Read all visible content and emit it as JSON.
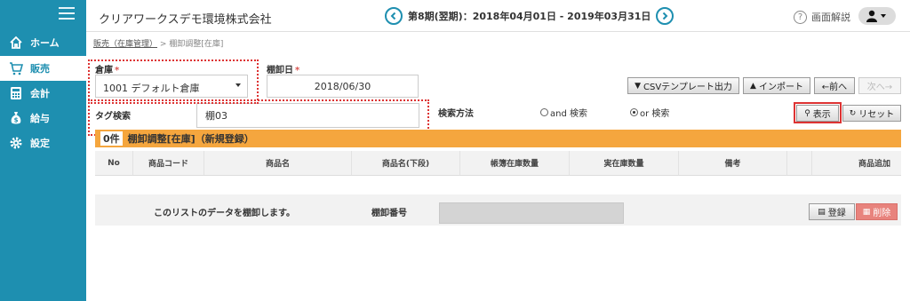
{
  "sidebar": {
    "items": [
      {
        "label": "ホーム",
        "icon": "home-icon"
      },
      {
        "label": "販売",
        "icon": "cart-icon"
      },
      {
        "label": "会計",
        "icon": "calculator-icon"
      },
      {
        "label": "給与",
        "icon": "money-bag-icon"
      },
      {
        "label": "設定",
        "icon": "gear-icon"
      }
    ]
  },
  "header": {
    "company": "クリアワークスデモ環境株式会社",
    "period": "第8期(翌期)：2018年04月01日 - 2019年03月31日",
    "help_label": "画面解説",
    "help_glyph": "?"
  },
  "breadcrumb": {
    "link": "販売（在庫管理）",
    "sep": ">",
    "current": "棚卸調整[在庫]"
  },
  "form": {
    "warehouse_label": "倉庫",
    "warehouse_value": "1001 デフォルト倉庫",
    "date_label": "棚卸日",
    "date_value": "2018/06/30",
    "required_mark": "*",
    "tag_label": "タグ検索",
    "tag_value": "棚03",
    "search_method_label": "検索方法",
    "radio_and": "and 検索",
    "radio_or": "or 検索",
    "radio_selected": "or"
  },
  "toolbar": {
    "csv": "CSVテンプレート出力",
    "import": "インポート",
    "prev": "←前へ",
    "next": "次へ→",
    "show": "表示",
    "reset": "リセット"
  },
  "section": {
    "count": "0件",
    "title": "棚卸調整[在庫]（新規登録）"
  },
  "table": {
    "columns": [
      "No",
      "商品コード",
      "商品名",
      "商品名(下段)",
      "帳簿在庫数量",
      "実在庫数量",
      "備考",
      "",
      "商品追加"
    ]
  },
  "footer": {
    "message": "このリストのデータを棚卸します。",
    "number_label": "棚卸番号",
    "register": "登録",
    "delete": "削除"
  },
  "colors": {
    "sidebar": "#1e8fb0",
    "section_header": "#f5a63e",
    "highlight": "#dd3333"
  }
}
